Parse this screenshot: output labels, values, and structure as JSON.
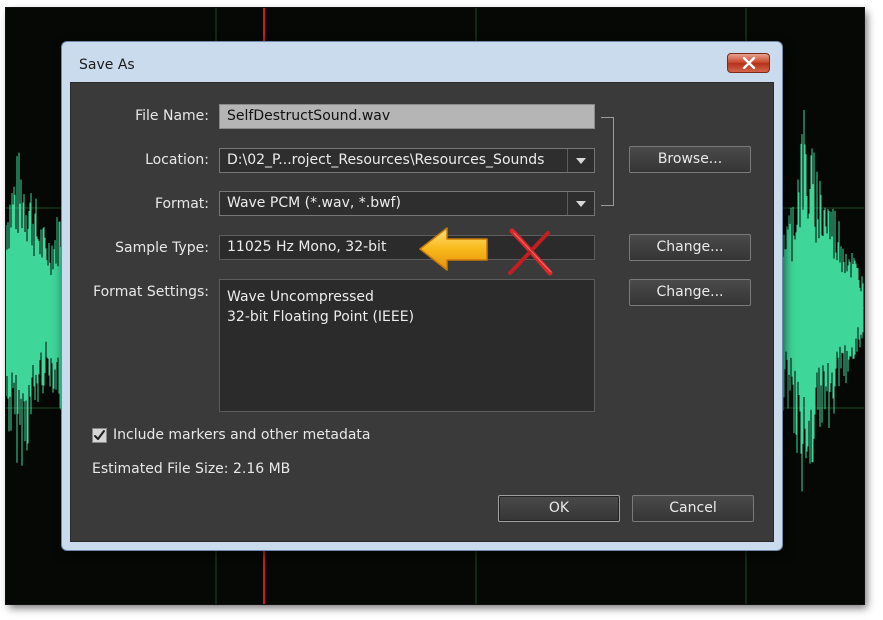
{
  "dialog": {
    "title": "Save As"
  },
  "form": {
    "file_name_label": "File Name:",
    "file_name_value": "SelfDestructSound.wav",
    "location_label": "Location:",
    "location_value": "D:\\02_P...roject_Resources\\Resources_Sounds",
    "format_label": "Format:",
    "format_value": "Wave PCM (*.wav, *.bwf)",
    "sample_type_label": "Sample Type:",
    "sample_type_value": "11025 Hz Mono, 32-bit",
    "format_settings_label": "Format Settings:",
    "format_settings_lines": [
      "Wave Uncompressed",
      "32-bit Floating Point (IEEE)"
    ],
    "include_markers_label": "Include markers and other metadata",
    "include_markers_checked": true,
    "estimated_size": "Estimated File Size: 2.16 MB"
  },
  "buttons": {
    "browse": "Browse...",
    "change_sample": "Change...",
    "change_format": "Change...",
    "ok": "OK",
    "cancel": "Cancel"
  },
  "annotations": {
    "arrow_color": "#f5b21a",
    "x_color": "#d8262a"
  },
  "colors": {
    "waveform": "#3fd69a",
    "dialog_bg": "#3a3a3a",
    "frame": "#c9dbec"
  }
}
